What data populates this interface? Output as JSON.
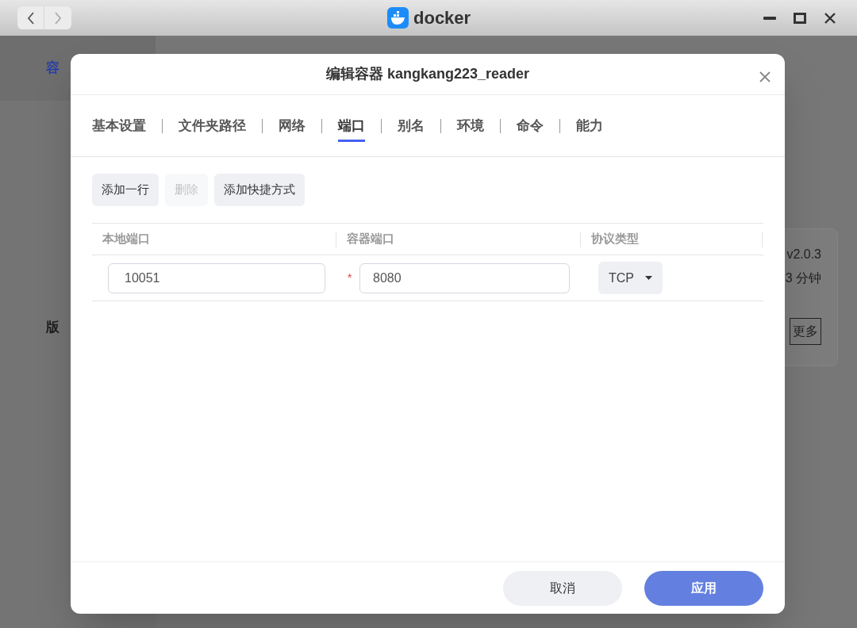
{
  "window": {
    "app_name": "docker"
  },
  "background": {
    "sidebar_items": [
      {
        "label": "容",
        "selected": true
      },
      {
        "label": "版",
        "selected": false
      }
    ],
    "info_card": {
      "version": "v2.0.3",
      "uptime": "3 分钟",
      "more_button": "更多"
    }
  },
  "dialog": {
    "title": "编辑容器 kangkang223_reader",
    "tabs": [
      {
        "label": "基本设置",
        "selected": false
      },
      {
        "label": "文件夹路径",
        "selected": false
      },
      {
        "label": "网络",
        "selected": false
      },
      {
        "label": "端口",
        "selected": true
      },
      {
        "label": "别名",
        "selected": false
      },
      {
        "label": "环境",
        "selected": false
      },
      {
        "label": "命令",
        "selected": false
      },
      {
        "label": "能力",
        "selected": false
      }
    ],
    "toolbar": [
      {
        "label": "添加一行",
        "disabled": false
      },
      {
        "label": "删除",
        "disabled": true
      },
      {
        "label": "添加快捷方式",
        "disabled": false
      }
    ],
    "table": {
      "columns": [
        "本地端口",
        "容器端口",
        "协议类型"
      ],
      "rows": [
        {
          "local_port": "10051",
          "container_port": "8080",
          "required_mark": "*",
          "protocol": "TCP"
        }
      ]
    },
    "buttons": [
      {
        "label": "取消",
        "kind": "secondary"
      },
      {
        "label": "应用",
        "kind": "primary"
      }
    ]
  }
}
